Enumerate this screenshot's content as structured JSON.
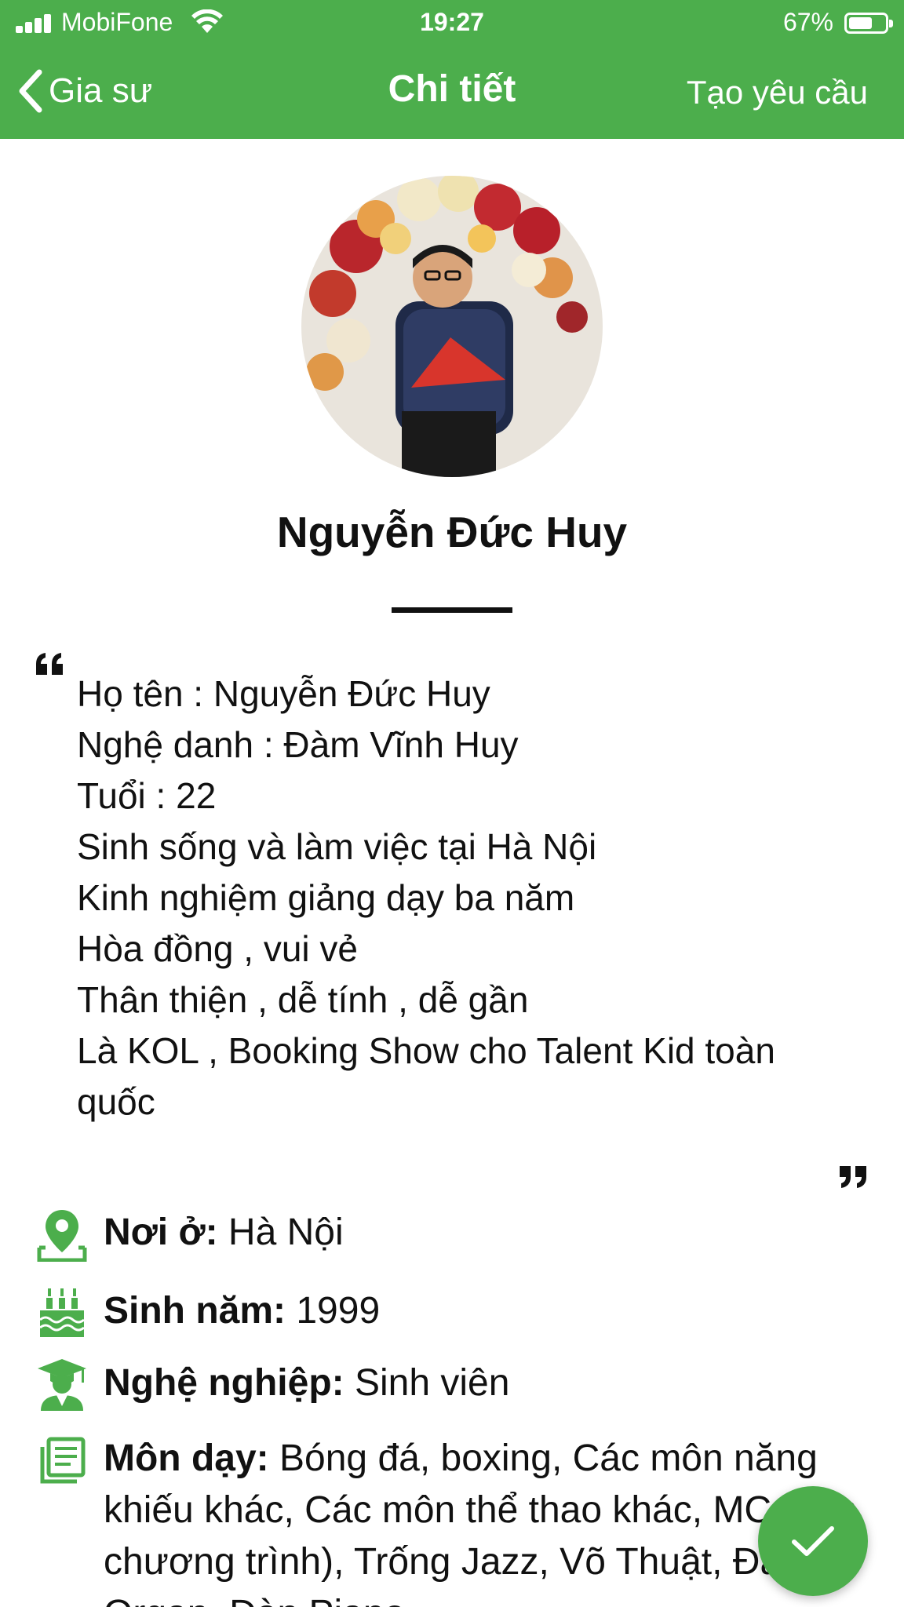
{
  "status_bar": {
    "carrier": "MobiFone",
    "time": "19:27",
    "battery": "67%",
    "battery_level": 0.67
  },
  "nav": {
    "back_label": "Gia sư",
    "title": "Chi tiết",
    "action_label": "Tạo yêu cầu"
  },
  "colors": {
    "brand_green": "#4cae4c"
  },
  "profile": {
    "name": "Nguyễn Đức Huy",
    "bio": [
      "Họ tên : Nguyễn Đức Huy",
      "Nghệ danh : Đàm Vĩnh Huy",
      "Tuổi : 22",
      "Sinh sống và làm việc tại Hà Nội",
      "Kinh nghiệm giảng dạy ba năm",
      "Hòa đồng , vui vẻ",
      "Thân thiện , dễ tính , dễ gần",
      "Là KOL , Booking Show cho Talent Kid toàn quốc"
    ]
  },
  "info": {
    "residence_label": "Nơi ở:",
    "residence_value": "Hà Nội",
    "birth_label": "Sinh năm:",
    "birth_value": "1999",
    "job_label": "Nghệ nghiệp:",
    "job_value": "Sinh viên",
    "subjects_label": "Môn dạy:",
    "subjects_value": "Bóng đá, boxing, Các môn năng khiếu khác, Các môn thể thao khác, MC (dẫn chương trình), Trống Jazz, Võ Thuật, Đàn Organ, Đàn Piano"
  },
  "icons": {
    "back": "chevron-left-icon",
    "residence": "map-pin-icon",
    "birth": "birthday-cake-icon",
    "job": "graduate-icon",
    "subjects": "document-list-icon",
    "fab": "check-icon"
  }
}
